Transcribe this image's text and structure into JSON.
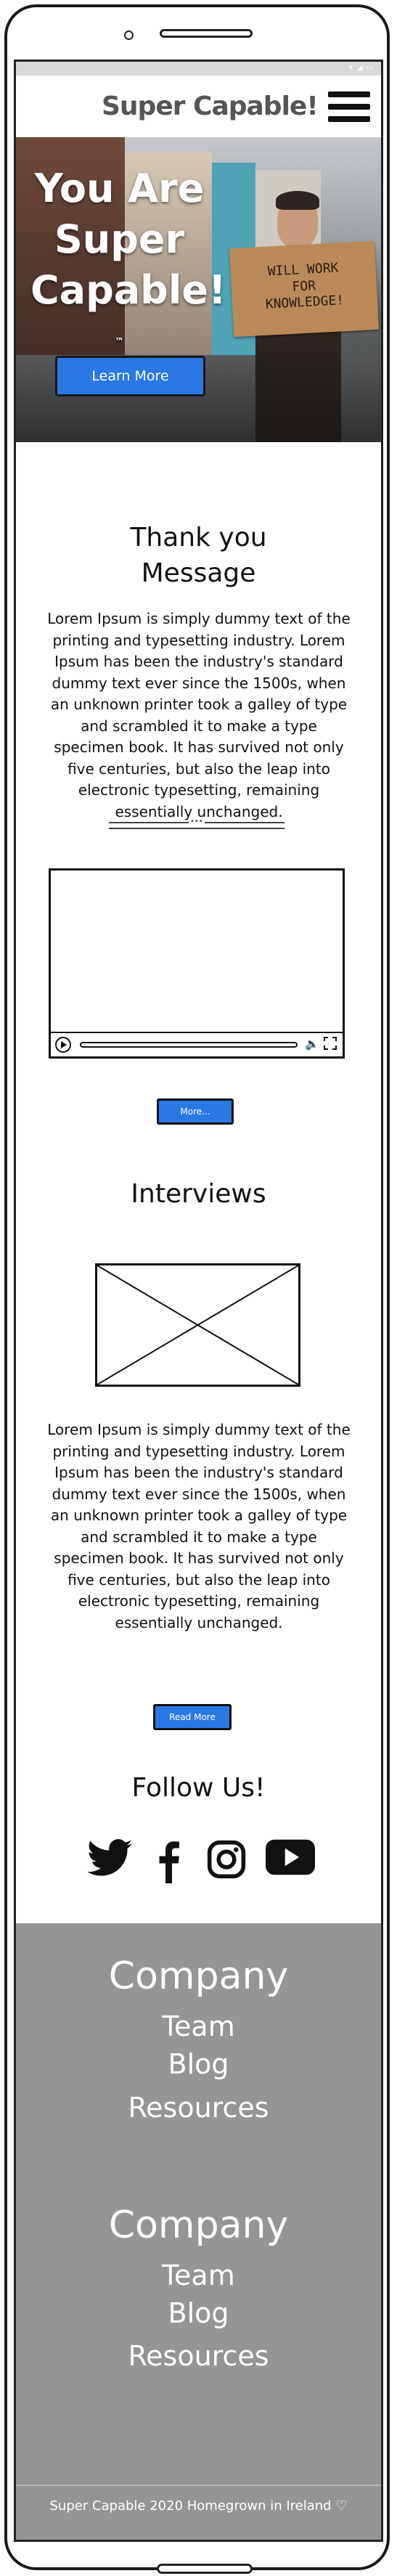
{
  "header": {
    "logo_text": "Super Capable!",
    "menu_icon": "hamburger-menu-icon"
  },
  "hero": {
    "title_lines": [
      "You Are",
      "Super",
      "Capable!"
    ],
    "trademark": "™",
    "sign_lines": [
      "WILL WORK",
      "FOR",
      "KNOWLEDGE!"
    ],
    "cta_label": "Learn More"
  },
  "thank_you": {
    "heading_line1": "Thank you",
    "heading_line2": "Message",
    "body": "Lorem Ipsum is simply dummy text of the printing and typesetting industry. Lorem Ipsum has been the industry's standard dummy text ever since the 1500s, when an unknown printer took a galley of type and scrambled it to make a type specimen book. It has survived not only five centuries, but also the leap into electronic typesetting, remaining essentially unchanged.",
    "divider_dots": "•••",
    "more_button": "More..."
  },
  "interviews": {
    "heading": "Interviews",
    "body": "Lorem Ipsum is simply dummy text of the printing and typesetting industry. Lorem Ipsum has been the industry's standard dummy text ever since the 1500s, when an unknown printer took a galley of type and scrambled it to make a type specimen book. It has survived not only five centuries, but also the leap into electronic typesetting, remaining essentially unchanged.",
    "read_more_button": "Read More"
  },
  "follow": {
    "heading": "Follow Us!",
    "icons": [
      "twitter-icon",
      "facebook-icon",
      "instagram-icon",
      "youtube-icon"
    ]
  },
  "footer": {
    "groups": [
      {
        "title": "Company",
        "links": [
          "Team",
          "Blog",
          "Resources"
        ]
      },
      {
        "title": "Company",
        "links": [
          "Team",
          "Blog",
          "Resources"
        ]
      }
    ],
    "copyright": "Super Capable 2020 Homegrown in Ireland",
    "heart_icon": "heart-icon"
  },
  "colors": {
    "accent_blue": "#2a78e4",
    "footer_gray": "#959595"
  }
}
